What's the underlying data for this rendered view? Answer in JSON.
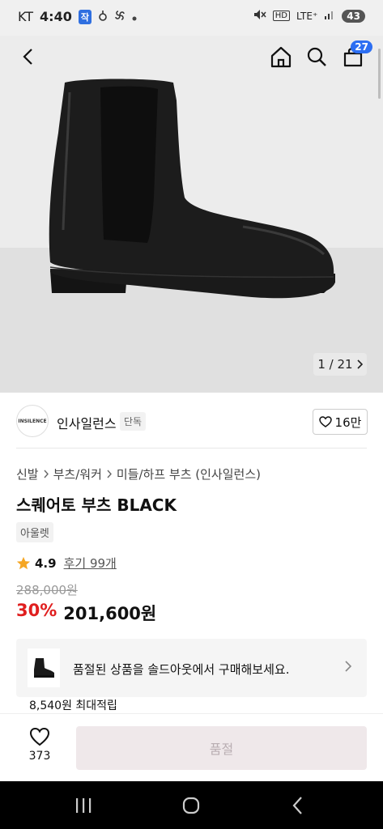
{
  "status_bar": {
    "carrier": "KT",
    "time": "4:40",
    "badge": "작",
    "network": "LTE⁺",
    "battery": "43",
    "hd": "HD"
  },
  "header": {
    "cart_count": "27"
  },
  "gallery": {
    "counter": "1 / 21"
  },
  "brand": {
    "logo_text": "INSILENCE",
    "name": "인사일런스",
    "tag": "단독",
    "likes": "16만"
  },
  "breadcrumb": [
    "신발",
    "부츠/워커",
    "미들/하프 부츠 (인사일런스)"
  ],
  "product": {
    "title": "스퀘어토 부츠 BLACK",
    "tag": "아울렛",
    "rating": "4.9",
    "reviews": "후기 99개",
    "original_price": "288,000원",
    "discount": "30%",
    "price": "201,600원"
  },
  "soldout": {
    "message": "품절된 상품을 솔드아웃에서 구매해보세요."
  },
  "points": "8,540원 최대적립",
  "bottom": {
    "wish_count": "373",
    "buy_label": "품절"
  },
  "colors": {
    "accent_blue": "#2c6ef2",
    "discount_red": "#e01f1f",
    "star": "#f5a623"
  }
}
